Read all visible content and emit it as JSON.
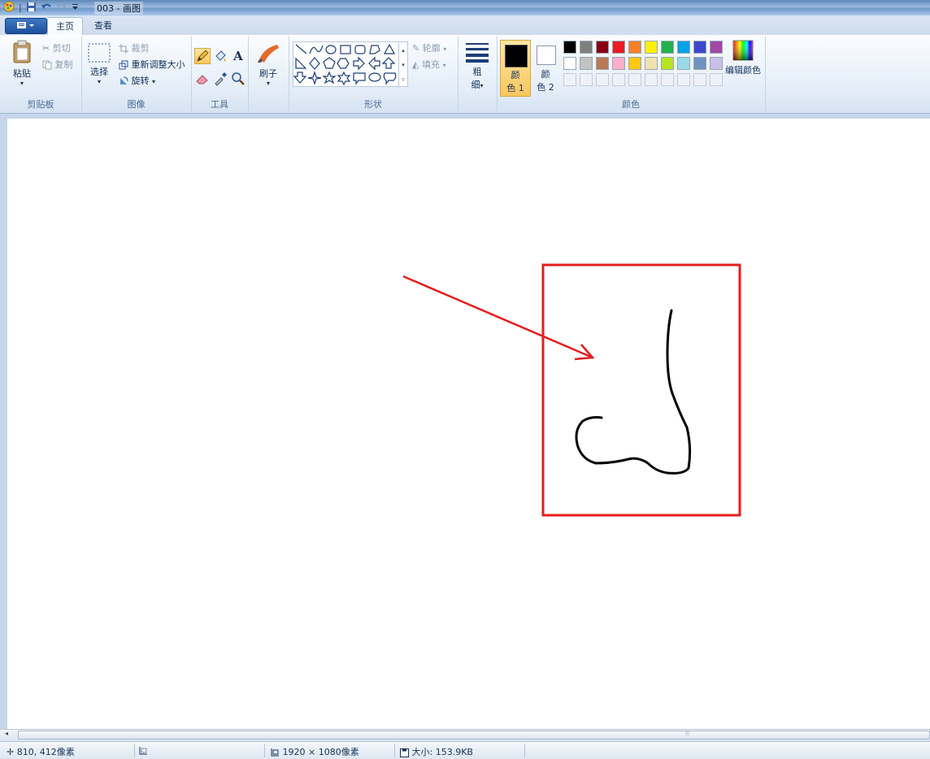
{
  "window": {
    "title": "003 - 画图"
  },
  "tabs": [
    {
      "label": "主页",
      "active": true
    },
    {
      "label": "查看",
      "active": false
    }
  ],
  "groups": {
    "clipboard": {
      "label": "剪贴板",
      "paste": "粘贴",
      "cut": "剪切",
      "copy": "复制"
    },
    "image": {
      "label": "图像",
      "select": "选择",
      "crop": "裁剪",
      "resize": "重新调整大小",
      "rotate": "旋转"
    },
    "tools": {
      "label": "工具"
    },
    "brushes": {
      "label": "刷子"
    },
    "shapes": {
      "label": "形状",
      "outline": "轮廓",
      "fill": "填充"
    },
    "size": {
      "label_line1": "粗",
      "label_line2": "细"
    },
    "colors": {
      "label": "颜色",
      "color1_line1": "颜",
      "color1_line2": "色 1",
      "color2_line1": "颜",
      "color2_line2": "色 2",
      "edit": "编辑颜色",
      "palette_row1": [
        "#000000",
        "#7f7f7f",
        "#880015",
        "#ed1c24",
        "#ff7f27",
        "#fff200",
        "#22b14c",
        "#00a2e8",
        "#3f48cc",
        "#a349a4"
      ],
      "palette_row2": [
        "#ffffff",
        "#c3c3c3",
        "#b97a57",
        "#ffaec9",
        "#ffc90e",
        "#efe4b0",
        "#b5e61d",
        "#99d9ea",
        "#7092be",
        "#c8bfe7"
      ]
    }
  },
  "canvas": {
    "annotation_color": "#e41e1e",
    "stroke_color": "#000000"
  },
  "statusbar": {
    "cursor": "810, 412像素",
    "image_size": "1920 × 1080像素",
    "file_size": "大小: 153.9KB"
  }
}
